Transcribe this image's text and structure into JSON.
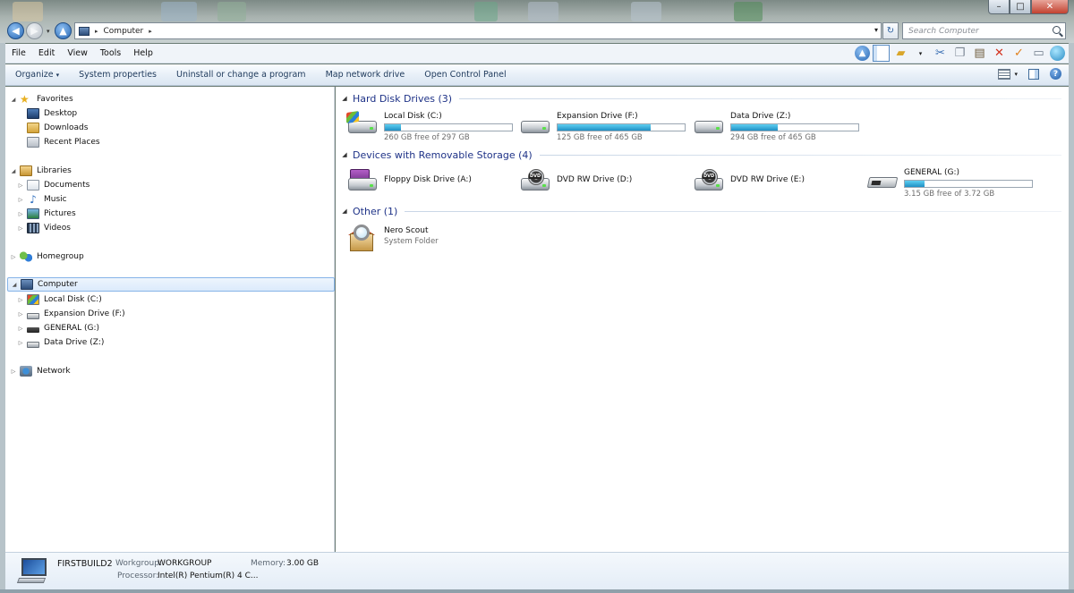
{
  "window": {
    "minimize_glyph": "–",
    "maximize_glyph": "□",
    "close_glyph": "✕"
  },
  "address": {
    "crumbs": [
      "Computer"
    ],
    "separator": "▸",
    "dropdown_glyph": "▾",
    "refresh_glyph": "↻"
  },
  "search": {
    "placeholder": "Search Computer"
  },
  "navigation": {
    "back_glyph": "◀",
    "forward_glyph": "▶",
    "up_glyph": "▲",
    "recent_glyph": "▾"
  },
  "menu": {
    "items": [
      "File",
      "Edit",
      "View",
      "Tools",
      "Help"
    ],
    "toolbar_icons": [
      "up-icon",
      "preview-pane-icon",
      "folder-options-icon",
      "cut-icon",
      "copy-icon",
      "paste-icon",
      "delete-icon",
      "properties-icon",
      "rename-icon",
      "globe-icon"
    ]
  },
  "commands": {
    "items": [
      "Organize",
      "System properties",
      "Uninstall or change a program",
      "Map network drive",
      "Open Control Panel"
    ],
    "organize_dropdown": "▾",
    "views_dropdown": "▾",
    "help_glyph": "?"
  },
  "nav_pane": {
    "expanded_glyph": "◢",
    "collapsed_glyph": "▷",
    "favorites": {
      "label": "Favorites",
      "items": [
        "Desktop",
        "Downloads",
        "Recent Places"
      ]
    },
    "libraries": {
      "label": "Libraries",
      "items": [
        "Documents",
        "Music",
        "Pictures",
        "Videos"
      ]
    },
    "homegroup": "Homegroup",
    "computer": {
      "label": "Computer",
      "items": [
        "Local Disk (C:)",
        "Expansion Drive (F:)",
        "GENERAL (G:)",
        "Data Drive (Z:)"
      ]
    },
    "network": "Network"
  },
  "content": {
    "groups": [
      {
        "title": "Hard Disk Drives (3)",
        "items": [
          {
            "name": "Local Disk (C:)",
            "free": "260 GB free of 297 GB",
            "used_fraction": 0.125
          },
          {
            "name": "Expansion Drive (F:)",
            "free": "125 GB free of 465 GB",
            "used_fraction": 0.731
          },
          {
            "name": "Data Drive (Z:)",
            "free": "294 GB free of 465 GB",
            "used_fraction": 0.368
          }
        ]
      },
      {
        "title": "Devices with Removable Storage (4)",
        "items": [
          {
            "name": "Floppy Disk Drive (A:)"
          },
          {
            "name": "DVD RW Drive (D:)"
          },
          {
            "name": "DVD RW Drive (E:)"
          },
          {
            "name": "GENERAL (G:)",
            "free": "3.15 GB free of 3.72 GB",
            "used_fraction": 0.153
          }
        ]
      },
      {
        "title": "Other (1)",
        "items": [
          {
            "name": "Nero Scout",
            "subtitle": "System Folder"
          }
        ]
      }
    ],
    "dvd_label": "DVD",
    "collapse_glyph": "◢"
  },
  "details": {
    "computer_name": "FIRSTBUILD2",
    "workgroup_label": "Workgroup:",
    "workgroup_value": "WORKGROUP",
    "memory_label": "Memory:",
    "memory_value": "3.00 GB",
    "processor_label": "Processor:",
    "processor_value": "Intel(R) Pentium(R) 4 C..."
  }
}
